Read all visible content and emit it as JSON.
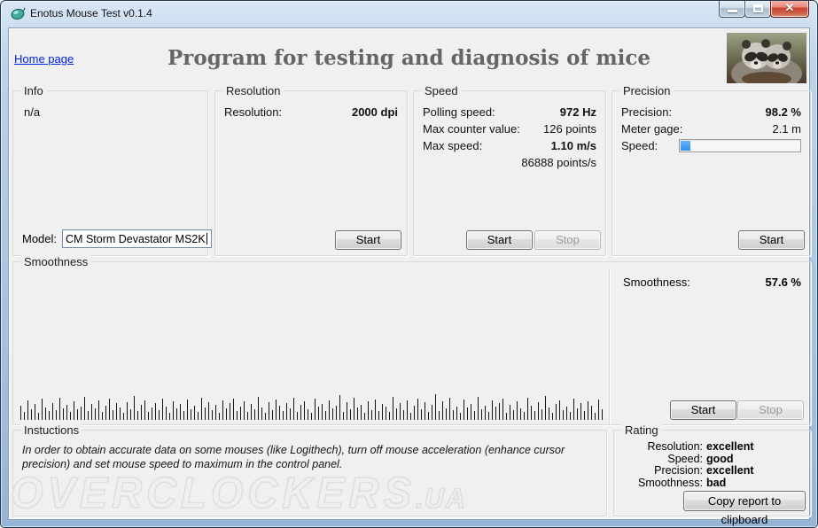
{
  "window": {
    "title": "Enotus Mouse Test v0.1.4",
    "controls": {
      "minimize": "minimize",
      "maximize": "maximize",
      "close": "✕"
    }
  },
  "header": {
    "home_link": "Home page",
    "app_title": "Program for testing and diagnosis of mice"
  },
  "info": {
    "legend": "Info",
    "status": "n/a",
    "model_label": "Model:",
    "model_value": "CM Storm Devastator MS2K"
  },
  "resolution": {
    "legend": "Resolution",
    "label": "Resolution:",
    "value": "2000 dpi",
    "start_label": "Start"
  },
  "speed": {
    "legend": "Speed",
    "rows": [
      {
        "label": "Polling speed:",
        "value": "972 Hz",
        "bold": true
      },
      {
        "label": "Max counter value:",
        "value": "126 points",
        "bold": false
      },
      {
        "label": "Max  speed:",
        "value": "1.10 m/s",
        "bold": true
      }
    ],
    "sub_value": "86888 points/s",
    "start_label": "Start",
    "stop_label": "Stop"
  },
  "precision": {
    "legend": "Precision",
    "rows": [
      {
        "label": "Precision:",
        "value": "98.2 %",
        "bold": true
      },
      {
        "label": "Meter gage:",
        "value": "2.1 m",
        "bold": false
      }
    ],
    "speed_label": "Speed:",
    "progress_percent": 8,
    "start_label": "Start"
  },
  "smoothness": {
    "legend": "Smoothness",
    "label": "Smoothness:",
    "value": "57.6 %",
    "start_label": "Start",
    "stop_label": "Stop",
    "bars": [
      16,
      9,
      22,
      12,
      18,
      8,
      24,
      14,
      10,
      19,
      11,
      25,
      13,
      17,
      9,
      21,
      12,
      15,
      26,
      10,
      18,
      13,
      22,
      9,
      16,
      24,
      11,
      19,
      14,
      8,
      20,
      12,
      27,
      10,
      17,
      22,
      9,
      14,
      19,
      11,
      24,
      15,
      8,
      21,
      13,
      18,
      10,
      23,
      12,
      16,
      9,
      25,
      14,
      20,
      11,
      17,
      8,
      22,
      13,
      19,
      24,
      10,
      15,
      21,
      9,
      18,
      12,
      26,
      14,
      8,
      20,
      11,
      23,
      16,
      10,
      19,
      13,
      25,
      9,
      17,
      21,
      12,
      8,
      24,
      15,
      18,
      10,
      22,
      13,
      16,
      28,
      9,
      20,
      12,
      25,
      14,
      17,
      8,
      21,
      11,
      23,
      10,
      18,
      15,
      9,
      26,
      13,
      19,
      11,
      22,
      8,
      16,
      24,
      12,
      20,
      9,
      17,
      29,
      10,
      21,
      13,
      25,
      11,
      15,
      8,
      23,
      14,
      18,
      10,
      26,
      12,
      16,
      9,
      22,
      15,
      19,
      24,
      8,
      17,
      11,
      21,
      13,
      9,
      25,
      16,
      10,
      20,
      12,
      27,
      14,
      8,
      18,
      22,
      11,
      15,
      9,
      24,
      13,
      19,
      10,
      21,
      16,
      8,
      23,
      12
    ]
  },
  "instructions": {
    "legend": "Instuctions",
    "text": "In order to obtain accurate data on some mouses (like Logithech), turn off mouse acceleration (enhance cursor precision) and set mouse speed to maximum in the control panel."
  },
  "rating": {
    "legend": "Rating",
    "rows": [
      {
        "label": "Resolution:",
        "value": "excellent"
      },
      {
        "label": "Speed:",
        "value": "good"
      },
      {
        "label": "Precision:",
        "value": "excellent"
      },
      {
        "label": "Smoothness:",
        "value": "bad"
      }
    ],
    "copy_button": "Copy report to clipboard"
  },
  "watermark": {
    "text": "OVERCLOCKERS",
    "suffix": ".UA"
  },
  "colors": {
    "accent_blue": "#3398fd",
    "close_red": "#c8402f"
  }
}
